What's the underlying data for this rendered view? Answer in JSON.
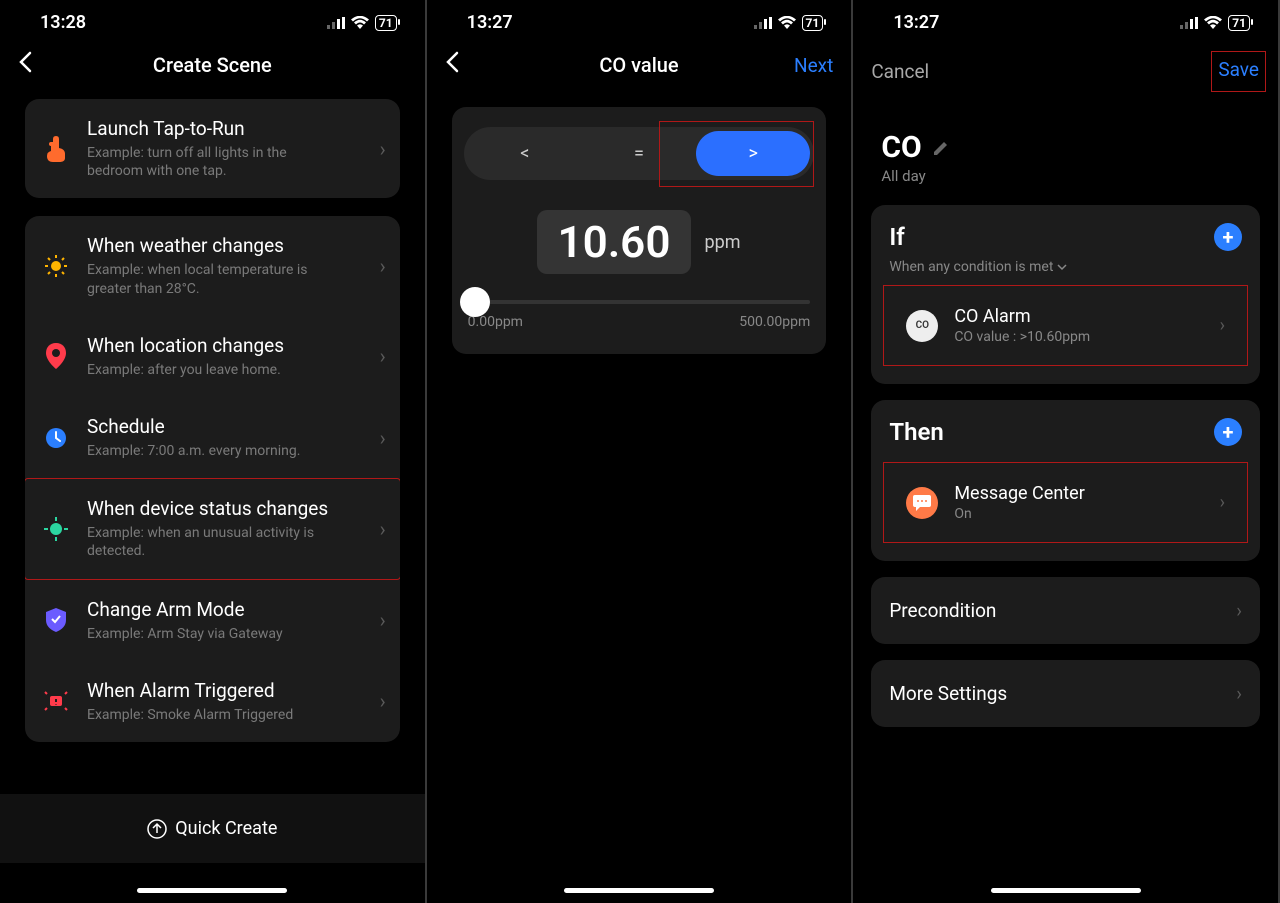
{
  "panel1": {
    "time": "13:28",
    "battery": "71",
    "title": "Create Scene",
    "items": [
      {
        "title": "Launch Tap-to-Run",
        "sub": "Example: turn off all lights in the bedroom with one tap.",
        "icon": "tap-icon",
        "color": "#ff6b2d"
      },
      {
        "title": "When weather changes",
        "sub": "Example: when local temperature is greater than 28°C.",
        "icon": "sun-icon",
        "color": "#ffb400"
      },
      {
        "title": "When location changes",
        "sub": "Example: after you leave home.",
        "icon": "location-icon",
        "color": "#ff3b4b"
      },
      {
        "title": "Schedule",
        "sub": "Example: 7:00 a.m. every morning.",
        "icon": "clock-icon",
        "color": "#2b7fff"
      },
      {
        "title": "When device status changes",
        "sub": "Example: when an unusual activity is detected.",
        "icon": "device-icon",
        "color": "#2bd6a0",
        "highlight": true
      },
      {
        "title": "Change Arm Mode",
        "sub": "Example: Arm Stay via Gateway",
        "icon": "shield-icon",
        "color": "#6b5bff"
      },
      {
        "title": "When Alarm Triggered",
        "sub": "Example: Smoke Alarm Triggered",
        "icon": "alarm-icon",
        "color": "#ff3b4b"
      }
    ],
    "quick_create": "Quick Create"
  },
  "panel2": {
    "time": "13:27",
    "battery": "71",
    "title": "CO value",
    "next": "Next",
    "operators": {
      "lt": "<",
      "eq": "=",
      "gt": ">"
    },
    "value": "10.60",
    "unit": "ppm",
    "min_label": "0.00ppm",
    "max_label": "500.00ppm"
  },
  "panel3": {
    "time": "13:27",
    "battery": "71",
    "cancel": "Cancel",
    "save": "Save",
    "name": "CO",
    "schedule": "All day",
    "if_label": "If",
    "if_sub": "When any condition is met",
    "condition": {
      "title": "CO Alarm",
      "sub": "CO value : >10.60ppm",
      "badge": "CO"
    },
    "then_label": "Then",
    "action": {
      "title": "Message Center",
      "sub": "On"
    },
    "precondition": "Precondition",
    "more_settings": "More Settings"
  }
}
